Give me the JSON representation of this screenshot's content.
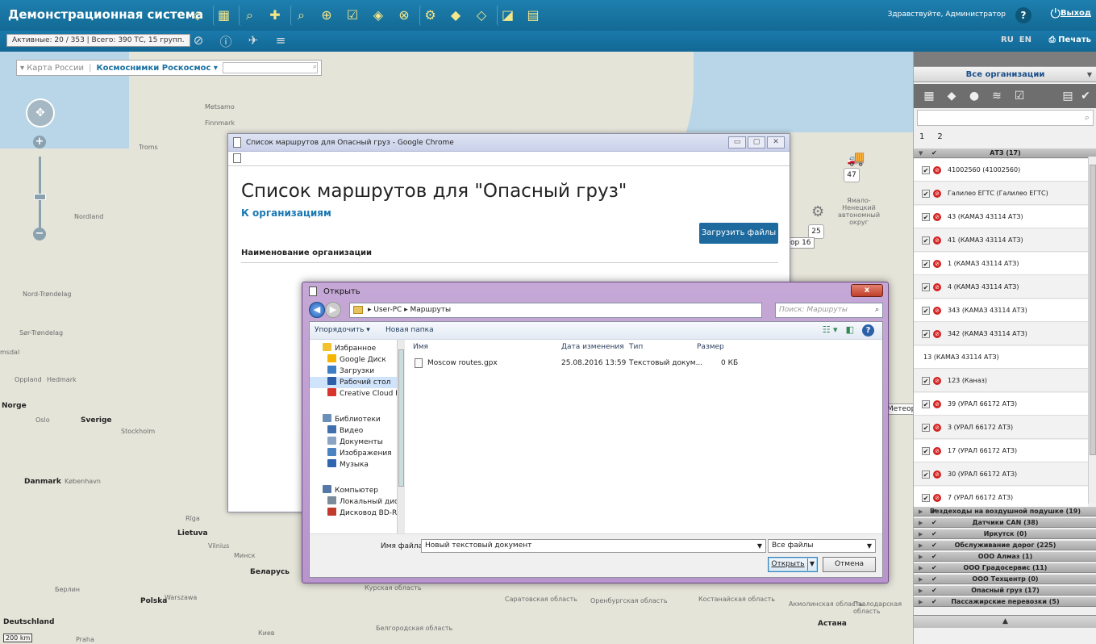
{
  "header": {
    "title": "Демонстрационная система",
    "greeting": "Здравствуйте, Администратор",
    "help": "?",
    "logout": "Выход"
  },
  "subbar": {
    "counts": "Активные: 20 / 353  |  Всего: 390 ТС, 15 групп.",
    "lang_ru": "RU",
    "lang_en": "EN",
    "print": "Печать"
  },
  "map": {
    "layer1": "Карта России",
    "layer2": "Космоснимки Роскосмос",
    "scale": "200 km",
    "labels": [
      {
        "text": "Finnmark"
      },
      {
        "text": "Troms"
      },
      {
        "text": "Nordland"
      },
      {
        "text": "Nord-Trøndelag"
      },
      {
        "text": "Sør-Trøndelag"
      },
      {
        "text": "msdal"
      },
      {
        "text": "Oppland"
      },
      {
        "text": "Hedmark"
      },
      {
        "text": "Norge"
      },
      {
        "text": "Oslo"
      },
      {
        "text": "Sverige"
      },
      {
        "text": "Stockholm"
      },
      {
        "text": "Danmark"
      },
      {
        "text": "København"
      },
      {
        "text": "Deutschland"
      },
      {
        "text": "Polska"
      },
      {
        "text": "Warszawa"
      },
      {
        "text": "Lietuva"
      },
      {
        "text": "Vilnius"
      },
      {
        "text": "Минск"
      },
      {
        "text": "Беларусь"
      },
      {
        "text": "Берлин"
      },
      {
        "text": "Praha"
      },
      {
        "text": "Киев"
      },
      {
        "text": "Ямало-Ненецкий автономный округ"
      },
      {
        "text": "Курская область"
      },
      {
        "text": "Белгородская область"
      },
      {
        "text": "Саратовская область"
      },
      {
        "text": "Оренбургская область"
      },
      {
        "text": "Костанайская область"
      },
      {
        "text": "Акмолинская область"
      },
      {
        "text": "Павлодарская область"
      },
      {
        "text": "Астана"
      },
      {
        "text": "Metsamo"
      },
      {
        "text": "Rīga"
      }
    ],
    "badges": [
      {
        "value": "47"
      },
      {
        "value": "25"
      }
    ],
    "tags": [
      {
        "text": "ор 16"
      },
      {
        "text": "Метеор"
      }
    ]
  },
  "chrome": {
    "title": "Список маршрутов для Опасный груз - Google Chrome",
    "heading": "Список маршрутов для \"Опасный груз\"",
    "to_orgs": "К организациям",
    "upload": "Загрузить файлы",
    "org_col": "Наименование организации"
  },
  "dialog": {
    "title": "Открыть",
    "close": "x",
    "path": "▸ User-PC ▸ Маршруты",
    "search_placeholder": "Поиск: Маршруты",
    "organize": "Упорядочить ▾",
    "new_folder": "Новая папка",
    "nav": [
      {
        "label": "Избранное",
        "color": "#f2c12e"
      },
      {
        "label": "Google Диск",
        "color": "#f4b400"
      },
      {
        "label": "Загрузки",
        "color": "#3c7fc4"
      },
      {
        "label": "Рабочий стол",
        "color": "#2d5fa8"
      },
      {
        "label": "Creative Cloud F",
        "color": "#d9342b"
      },
      {
        "label": "Библиотеки",
        "color": "#6a8fb8"
      },
      {
        "label": "Видео",
        "color": "#3f6fae"
      },
      {
        "label": "Документы",
        "color": "#8aa4c4"
      },
      {
        "label": "Изображения",
        "color": "#4a83bf"
      },
      {
        "label": "Музыка",
        "color": "#2f66b0"
      },
      {
        "label": "Компьютер",
        "color": "#5578a6"
      },
      {
        "label": "Локальный диск",
        "color": "#7a8b9c"
      },
      {
        "label": "Дисковод BD-RC",
        "color": "#c23a2c"
      }
    ],
    "columns": {
      "name": "Имя",
      "date": "Дата изменения",
      "type": "Тип",
      "size": "Размер"
    },
    "files": [
      {
        "name": "Moscow routes.gpx",
        "date": "25.08.2016 13:59",
        "type": "Текстовый докум...",
        "size": "0 КБ"
      }
    ],
    "filename_label": "Имя файла:",
    "filename_value": "Новый текстовый документ",
    "filetype": "Все файлы",
    "open": "Открыть",
    "cancel": "Отмена"
  },
  "sidebar": {
    "all_orgs": "Все организации",
    "tab1": "1",
    "tab2": "2",
    "groups_top": [
      {
        "name": "АТЗ (17)"
      }
    ],
    "vehicles": [
      {
        "label": "41002560 (41002560)"
      },
      {
        "label": "Галилео ЕГТС (Галилео ЕГТС)"
      },
      {
        "label": "43 (КАМАЗ 43114 АТЗ)"
      },
      {
        "label": "41 (КАМАЗ 43114 АТЗ)"
      },
      {
        "label": "1 (КАМАЗ 43114 АТЗ)"
      },
      {
        "label": "4 (КАМАЗ 43114 АТЗ)"
      },
      {
        "label": "343 (КАМАЗ 43114 АТЗ)"
      },
      {
        "label": "342 (КАМАЗ 43114 АТЗ)"
      },
      {
        "label": "13 (КАМАЗ 43114 АТЗ)"
      },
      {
        "label": "123 (Каназ)"
      },
      {
        "label": "39 (УРАЛ 66172 АТЗ)"
      },
      {
        "label": "3 (УРАЛ 66172 АТЗ)"
      },
      {
        "label": "17 (УРАЛ 66172 АТЗ)"
      },
      {
        "label": "30 (УРАЛ 66172 АТЗ)"
      },
      {
        "label": "7 (УРАЛ 66172 АТЗ)"
      }
    ],
    "groups": [
      {
        "name": "Вездеходы на воздушной подушке (19)"
      },
      {
        "name": "Датчики CAN (38)"
      },
      {
        "name": "Иркутск (0)"
      },
      {
        "name": "Обслуживание дорог (225)"
      },
      {
        "name": "ООО Алмаз (1)"
      },
      {
        "name": "ООО Градосервис (11)"
      },
      {
        "name": "ООО Техцентр (0)"
      },
      {
        "name": "Опасный груз (17)"
      },
      {
        "name": "Пассажирские перевозки (5)"
      }
    ]
  }
}
